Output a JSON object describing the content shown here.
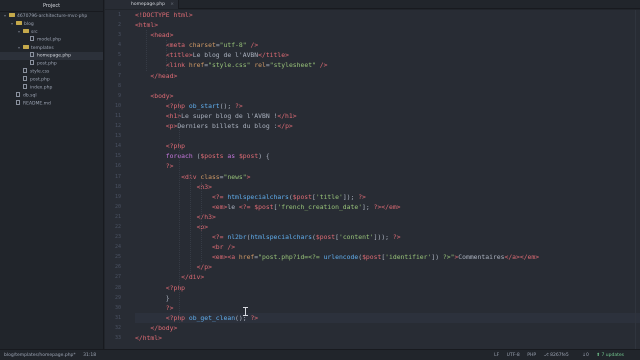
{
  "sidebar": {
    "title": "Project",
    "tree": [
      {
        "depth": 0,
        "type": "folder",
        "open": true,
        "label": "4670796-architecture-mvc-php",
        "selected": false
      },
      {
        "depth": 1,
        "type": "folder",
        "open": true,
        "label": "blog",
        "selected": false
      },
      {
        "depth": 2,
        "type": "folder",
        "open": true,
        "label": "src",
        "selected": false
      },
      {
        "depth": 3,
        "type": "file",
        "label": "model.php",
        "selected": false
      },
      {
        "depth": 2,
        "type": "folder",
        "open": true,
        "label": "templates",
        "selected": false
      },
      {
        "depth": 3,
        "type": "file",
        "label": "homepage.php",
        "selected": true
      },
      {
        "depth": 3,
        "type": "file",
        "label": "post.php",
        "selected": false
      },
      {
        "depth": 2,
        "type": "file",
        "label": "style.css",
        "selected": false
      },
      {
        "depth": 2,
        "type": "file",
        "label": "post.php",
        "selected": false
      },
      {
        "depth": 2,
        "type": "file",
        "label": "index.php",
        "selected": false
      },
      {
        "depth": 1,
        "type": "file",
        "label": "db.sql",
        "selected": false
      },
      {
        "depth": 1,
        "type": "file",
        "label": "README.md",
        "selected": false
      }
    ]
  },
  "tab": {
    "label": "homepage.php",
    "close": "×"
  },
  "editor": {
    "line_numbers": [
      "1",
      "2",
      "3",
      "4",
      "5",
      "6",
      "7",
      "8",
      "9",
      "10",
      "11",
      "12",
      "13",
      "14",
      "15",
      "16",
      "17",
      "18",
      "19",
      "20",
      "21",
      "22",
      "23",
      "24",
      "25",
      "26",
      "27",
      "28",
      "29",
      "30",
      "31",
      "32",
      "33"
    ],
    "cursor_line": 31,
    "lines": [
      [
        [
          "tg",
          "<!DOCTYPE html>"
        ]
      ],
      [
        [
          "tg",
          "<html>"
        ]
      ],
      [
        [
          "pl",
          "    "
        ],
        [
          "tg",
          "<head>"
        ]
      ],
      [
        [
          "pl",
          "        "
        ],
        [
          "tg",
          "<meta "
        ],
        [
          "at",
          "charset"
        ],
        [
          "pl",
          "="
        ],
        [
          "st",
          "\"utf-8\""
        ],
        [
          "pl",
          " "
        ],
        [
          "tg",
          "/>"
        ]
      ],
      [
        [
          "pl",
          "        "
        ],
        [
          "tg",
          "<title>"
        ],
        [
          "pl",
          "Le blog de l'AVBN"
        ],
        [
          "tg",
          "</title>"
        ]
      ],
      [
        [
          "pl",
          "        "
        ],
        [
          "tg",
          "<link "
        ],
        [
          "at",
          "href"
        ],
        [
          "pl",
          "="
        ],
        [
          "st",
          "\"style.css\""
        ],
        [
          "pl",
          " "
        ],
        [
          "at",
          "rel"
        ],
        [
          "pl",
          "="
        ],
        [
          "st",
          "\"stylesheet\""
        ],
        [
          "pl",
          " "
        ],
        [
          "tg",
          "/>"
        ]
      ],
      [
        [
          "pl",
          "    "
        ],
        [
          "tg",
          "</head>"
        ]
      ],
      [
        [
          "pl",
          ""
        ]
      ],
      [
        [
          "pl",
          "    "
        ],
        [
          "tg",
          "<body>"
        ]
      ],
      [
        [
          "pl",
          "        "
        ],
        [
          "ph",
          "<?php "
        ],
        [
          "fn",
          "ob_start"
        ],
        [
          "pl",
          "(); "
        ],
        [
          "ph",
          "?>"
        ]
      ],
      [
        [
          "pl",
          "        "
        ],
        [
          "tg",
          "<h1>"
        ],
        [
          "pl",
          "Le super blog de l'AVBN !"
        ],
        [
          "tg",
          "</h1>"
        ]
      ],
      [
        [
          "pl",
          "        "
        ],
        [
          "tg",
          "<p>"
        ],
        [
          "pl",
          "Derniers billets du blog :"
        ],
        [
          "tg",
          "</p>"
        ]
      ],
      [
        [
          "pl",
          ""
        ]
      ],
      [
        [
          "pl",
          "        "
        ],
        [
          "ph",
          "<?php"
        ]
      ],
      [
        [
          "pl",
          "        "
        ],
        [
          "kw",
          "foreach"
        ],
        [
          "pl",
          " ("
        ],
        [
          "vr",
          "$posts"
        ],
        [
          "pl",
          " "
        ],
        [
          "kw",
          "as"
        ],
        [
          "pl",
          " "
        ],
        [
          "vr",
          "$post"
        ],
        [
          "pl",
          ") {"
        ]
      ],
      [
        [
          "pl",
          "        "
        ],
        [
          "ph",
          "?>"
        ]
      ],
      [
        [
          "pl",
          "            "
        ],
        [
          "tg",
          "<div "
        ],
        [
          "at",
          "class"
        ],
        [
          "pl",
          "="
        ],
        [
          "st",
          "\"news\""
        ],
        [
          "tg",
          ">"
        ]
      ],
      [
        [
          "pl",
          "                "
        ],
        [
          "tg",
          "<h3>"
        ]
      ],
      [
        [
          "pl",
          "                    "
        ],
        [
          "ph",
          "<?= "
        ],
        [
          "fn",
          "htmlspecialchars"
        ],
        [
          "pl",
          "("
        ],
        [
          "vr",
          "$post"
        ],
        [
          "pl",
          "["
        ],
        [
          "st",
          "'title'"
        ],
        [
          "pl",
          "]); "
        ],
        [
          "ph",
          "?>"
        ]
      ],
      [
        [
          "pl",
          "                    "
        ],
        [
          "tg",
          "<em>"
        ],
        [
          "pl",
          "le "
        ],
        [
          "ph",
          "<?= "
        ],
        [
          "vr",
          "$post"
        ],
        [
          "pl",
          "["
        ],
        [
          "st",
          "'french_creation_date'"
        ],
        [
          "pl",
          "]; "
        ],
        [
          "ph",
          "?>"
        ],
        [
          "tg",
          "</em>"
        ]
      ],
      [
        [
          "pl",
          "                "
        ],
        [
          "tg",
          "</h3>"
        ]
      ],
      [
        [
          "pl",
          "                "
        ],
        [
          "tg",
          "<p>"
        ]
      ],
      [
        [
          "pl",
          "                    "
        ],
        [
          "ph",
          "<?= "
        ],
        [
          "fn",
          "nl2br"
        ],
        [
          "pl",
          "("
        ],
        [
          "fn",
          "htmlspecialchars"
        ],
        [
          "pl",
          "("
        ],
        [
          "vr",
          "$post"
        ],
        [
          "pl",
          "["
        ],
        [
          "st",
          "'content'"
        ],
        [
          "pl",
          "])); "
        ],
        [
          "ph",
          "?>"
        ]
      ],
      [
        [
          "pl",
          "                    "
        ],
        [
          "tg",
          "<br />"
        ]
      ],
      [
        [
          "pl",
          "                    "
        ],
        [
          "tg",
          "<em><a "
        ],
        [
          "at",
          "href"
        ],
        [
          "pl",
          "="
        ],
        [
          "st",
          "\"post.php?id=<?= "
        ],
        [
          "fn",
          "urlencode"
        ],
        [
          "pl",
          "("
        ],
        [
          "vr",
          "$post"
        ],
        [
          "pl",
          "["
        ],
        [
          "st",
          "'identifier'"
        ],
        [
          "pl",
          "]) "
        ],
        [
          "st",
          "?>\""
        ],
        [
          "tg",
          ">"
        ],
        [
          "pl",
          "Commentaires"
        ],
        [
          "tg",
          "</a></em>"
        ]
      ],
      [
        [
          "pl",
          "                "
        ],
        [
          "tg",
          "</p>"
        ]
      ],
      [
        [
          "pl",
          "            "
        ],
        [
          "tg",
          "</div>"
        ]
      ],
      [
        [
          "pl",
          "        "
        ],
        [
          "ph",
          "<?php"
        ]
      ],
      [
        [
          "pl",
          "        }"
        ]
      ],
      [
        [
          "pl",
          "        "
        ],
        [
          "ph",
          "?>"
        ]
      ],
      [
        [
          "pl",
          "        "
        ],
        [
          "ph",
          "<?php "
        ],
        [
          "fn",
          "ob_get_clean"
        ],
        [
          "pl",
          "(); "
        ],
        [
          "ph",
          "?>"
        ]
      ],
      [
        [
          "pl",
          "    "
        ],
        [
          "tg",
          "</body>"
        ]
      ],
      [
        [
          "tg",
          "</html>"
        ]
      ]
    ]
  },
  "status": {
    "file_path": "blog/templates/homepage.php*",
    "cursor_pos": "31:18",
    "line_ending": "LF",
    "encoding": "UTF-8",
    "grammar": "PHP",
    "git_branch": "8267fe5",
    "git_changes": "↓0",
    "updates": "7 updates"
  },
  "colors": {
    "editor_bg": "#282c34",
    "sidebar_bg": "#21252b",
    "selection": "#2c313a",
    "accent_green": "#73c990"
  }
}
